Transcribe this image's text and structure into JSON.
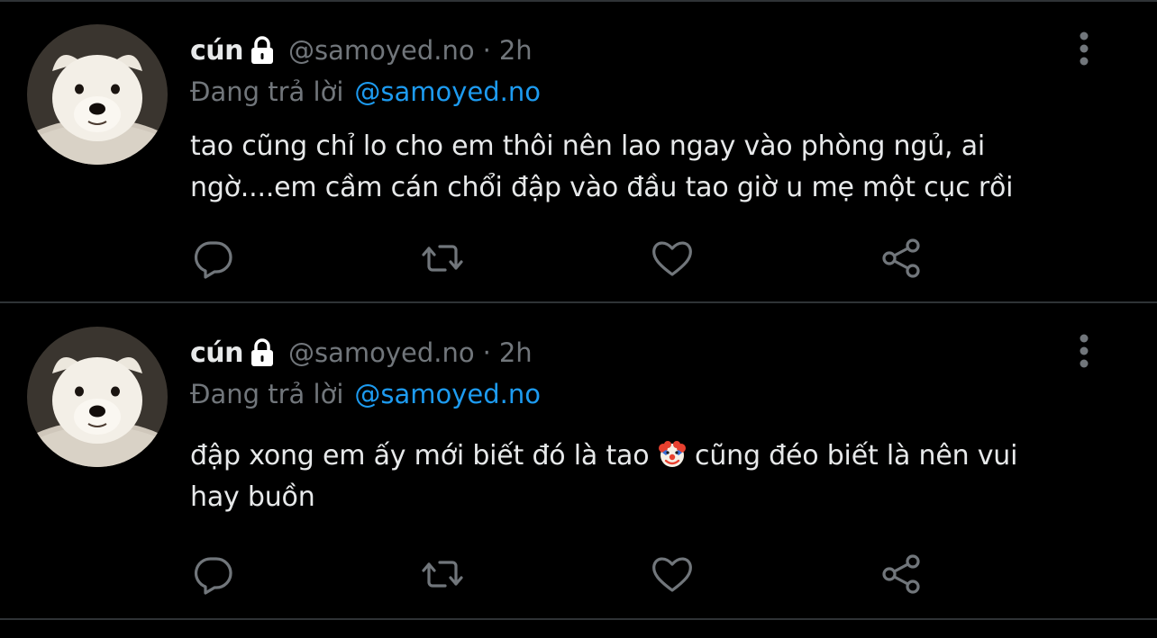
{
  "colors": {
    "background": "#000000",
    "primary_text": "#e7e9ea",
    "secondary_text": "#71767b",
    "link": "#1d9bf0",
    "divider": "#2f3336"
  },
  "tweets": [
    {
      "display_name": "cún",
      "protected_icon": "lock-icon",
      "handle": "@samoyed.no",
      "separator": "·",
      "time": "2h",
      "reply_prefix": "Đang trả lời",
      "reply_to": "@samoyed.no",
      "text_lines": [
        "tao cũng chỉ lo cho em thôi nên lao ngay vào phòng ngủ, ai",
        "ngờ....em cầm cán chổi đập vào đầu tao giờ u mẹ một cục rồi"
      ],
      "actions": [
        "reply-icon",
        "retweet-icon",
        "like-icon",
        "share-icon"
      ],
      "menu_icon": "more-vertical-icon"
    },
    {
      "display_name": "cún",
      "protected_icon": "lock-icon",
      "handle": "@samoyed.no",
      "separator": "·",
      "time": "2h",
      "reply_prefix": "Đang trả lời",
      "reply_to": "@samoyed.no",
      "text_before_emoji": "đập xong em ấy mới biết đó là tao ",
      "emoji": "clown-face-emoji",
      "text_after_emoji": " cũng đéo biết là nên vui",
      "text_line_2": "hay buồn",
      "actions": [
        "reply-icon",
        "retweet-icon",
        "like-icon",
        "share-icon"
      ],
      "menu_icon": "more-vertical-icon"
    }
  ]
}
